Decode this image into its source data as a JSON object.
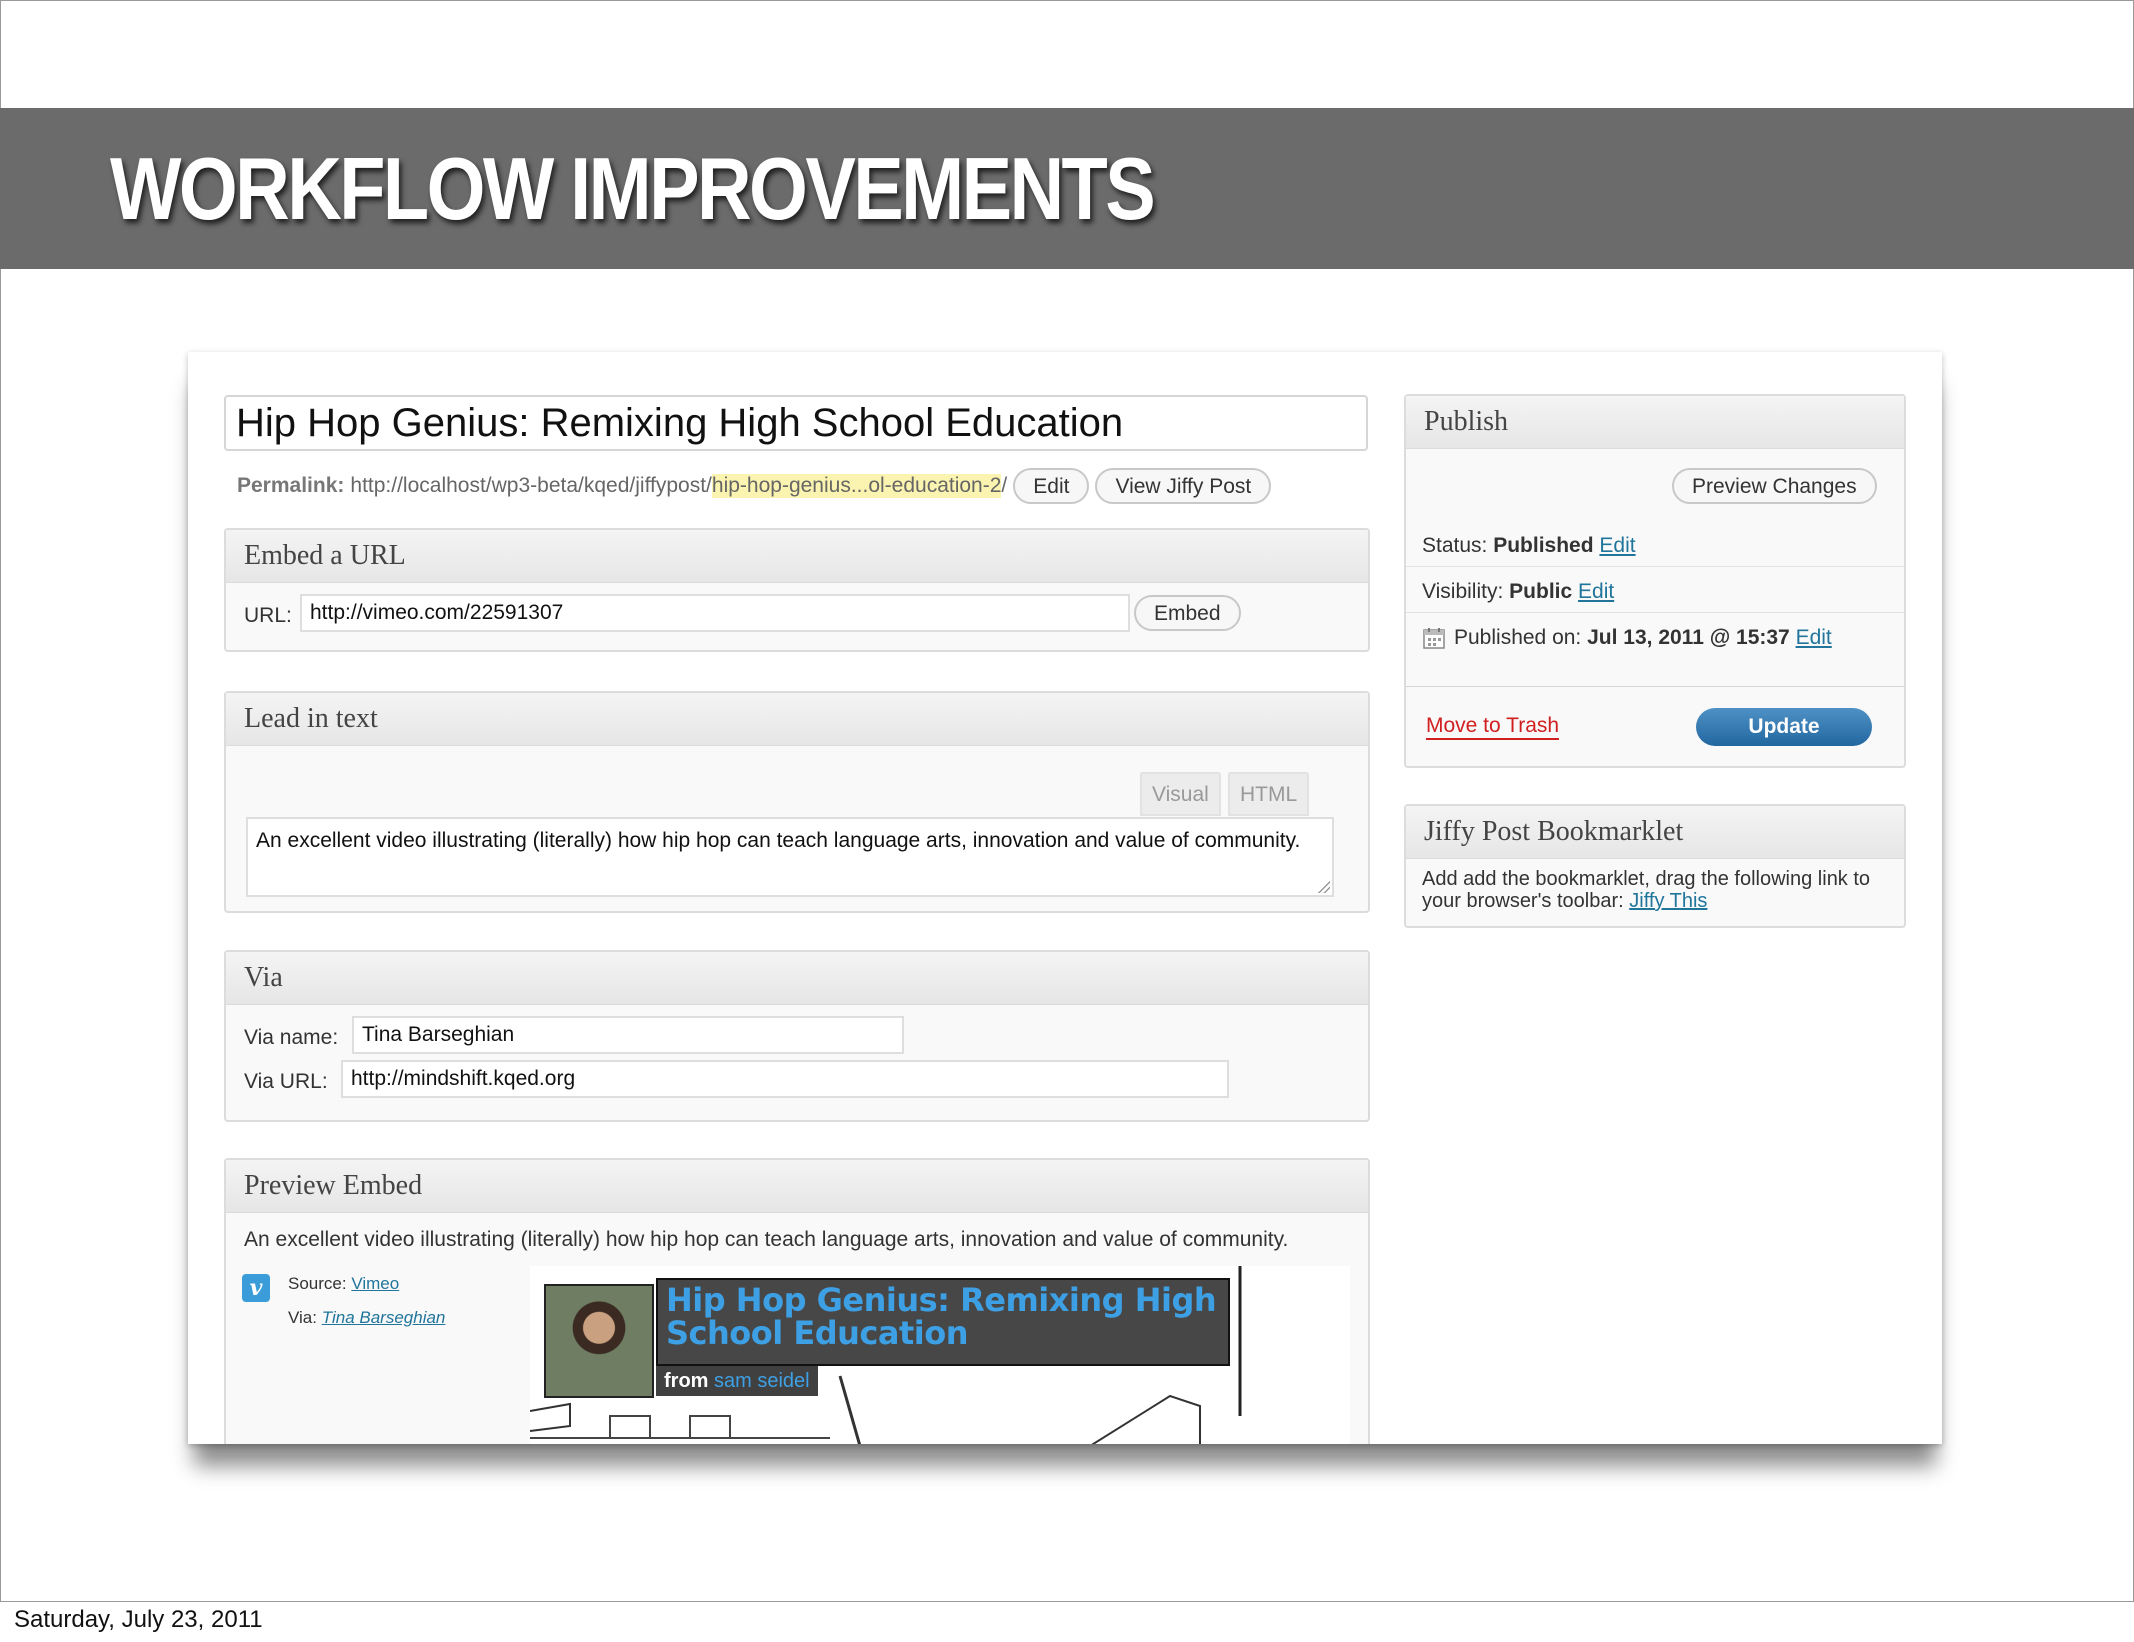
{
  "slide": {
    "title": "WORKFLOW IMPROVEMENTS",
    "footer_date": "Saturday, July 23, 2011"
  },
  "post": {
    "title": "Hip Hop Genius: Remixing High School Education",
    "permalink_label": "Permalink:",
    "permalink_base": "http://localhost/wp3-beta/kqed/jiffypost/",
    "permalink_slug": "hip-hop-genius...ol-education-2",
    "permalink_trailing": "/",
    "edit_button": "Edit",
    "view_button": "View Jiffy Post"
  },
  "embed_url": {
    "heading": "Embed a URL",
    "url_label": "URL:",
    "url_value": "http://vimeo.com/22591307",
    "embed_button": "Embed"
  },
  "lead_in": {
    "heading": "Lead in text",
    "tab_visual": "Visual",
    "tab_html": "HTML",
    "text": "An excellent video illustrating (literally) how hip hop can teach language arts, innovation and value of community."
  },
  "via": {
    "heading": "Via",
    "name_label": "Via name:",
    "name_value": "Tina Barseghian",
    "url_label": "Via URL:",
    "url_value": "http://mindshift.kqed.org"
  },
  "preview": {
    "heading": "Preview Embed",
    "text": "An excellent video illustrating (literally) how hip hop can teach language arts, innovation and value of community.",
    "source_label": "Source:",
    "source_link": "Vimeo",
    "via_label": "Via:",
    "via_link": "Tina Barseghian",
    "video_title": "Hip Hop Genius: Remixing High School Education",
    "video_from": "from",
    "video_author": "sam seidel",
    "vimeo_badge": "v"
  },
  "publish": {
    "heading": "Publish",
    "preview_button": "Preview Changes",
    "status_label": "Status:",
    "status_value": "Published",
    "visibility_label": "Visibility:",
    "visibility_value": "Public",
    "published_label": "Published on:",
    "published_value": "Jul 13, 2011 @ 15:37",
    "edit_link": "Edit",
    "trash_link": "Move to Trash",
    "update_button": "Update"
  },
  "bookmarklet": {
    "heading": "Jiffy Post Bookmarklet",
    "text": "Add add the bookmarklet, drag the following link to your browser's toolbar:",
    "link": "Jiffy This"
  },
  "icons": {
    "calendar": "calendar-icon",
    "vimeo": "vimeo-icon"
  },
  "colors": {
    "title_bar": "#6b6b6b",
    "link": "#21759b",
    "update_button": "#2e79b5",
    "trash": "#d01f1f",
    "permalink_highlight": "#fbf3b0"
  }
}
